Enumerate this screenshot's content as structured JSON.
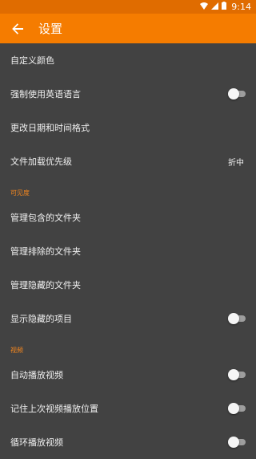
{
  "status_bar": {
    "time": "9:14"
  },
  "app_bar": {
    "title": "设置"
  },
  "rows": [
    {
      "label": "自定义颜色"
    },
    {
      "label": "强制使用英语语言"
    },
    {
      "label": "更改日期和时间格式"
    },
    {
      "label": "文件加载优先级",
      "value": "折中"
    }
  ],
  "visibility": {
    "header": "可见度",
    "rows": [
      {
        "label": "管理包含的文件夹"
      },
      {
        "label": "管理排除的文件夹"
      },
      {
        "label": "管理隐藏的文件夹"
      },
      {
        "label": "显示隐藏的项目"
      }
    ]
  },
  "video": {
    "header": "视频",
    "rows": [
      {
        "label": "自动播放视频"
      },
      {
        "label": "记住上次视频播放位置"
      },
      {
        "label": "循环播放视频"
      }
    ]
  },
  "colors": {
    "accent": "#f57c00",
    "background": "#424242",
    "section_header": "#f5871e"
  }
}
